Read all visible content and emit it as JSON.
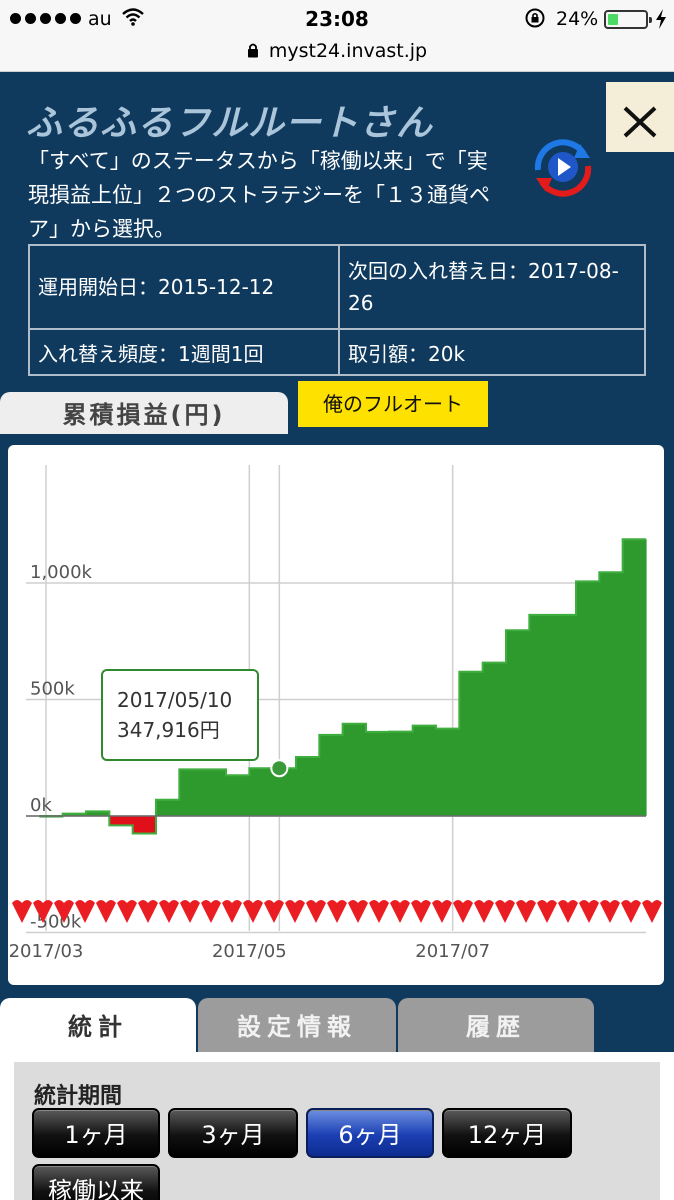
{
  "status_bar": {
    "carrier": "au",
    "time": "23:08",
    "battery_pct": "24%",
    "battery_level": 0.24
  },
  "url_bar": {
    "url": "myst24.invast.jp"
  },
  "header": {
    "title": "ふるふるフルルートさん",
    "description": "「すべて」のステータスから「稼働以来」で「実現損益上位」２つのストラテジーを「１３通貨ペア」から選択。"
  },
  "info": {
    "start_date": "運用開始日：2015-12-12",
    "next_swap_date": "次回の入れ替え日：2017-08-26",
    "swap_freq": "入れ替え頻度：1週間1回",
    "trade_amount": "取引額：20k"
  },
  "tabs_top": {
    "chart_tab": "累積損益(円)",
    "auto_tab": "俺のフルオート"
  },
  "chart_data": {
    "type": "area",
    "xlabel": "",
    "ylabel": "",
    "x_ticks": [
      "2017/03",
      "2017/05",
      "2017/07"
    ],
    "y_ticks": [
      "1,000k",
      "500k",
      "0k",
      "-500k"
    ],
    "ylim": [
      -500000,
      1300000
    ],
    "grid": true,
    "x": [
      "2017/02/27",
      "2017/03/06",
      "2017/03/13",
      "2017/03/20",
      "2017/03/27",
      "2017/04/03",
      "2017/04/10",
      "2017/04/17",
      "2017/04/24",
      "2017/05/01",
      "2017/05/08",
      "2017/05/15",
      "2017/05/22",
      "2017/05/29",
      "2017/06/05",
      "2017/06/12",
      "2017/06/19",
      "2017/06/26",
      "2017/07/03",
      "2017/07/10",
      "2017/07/17",
      "2017/07/24",
      "2017/07/31",
      "2017/08/07",
      "2017/08/14",
      "2017/08/21"
    ],
    "values": [
      0,
      10000,
      20000,
      -40000,
      -75000,
      70000,
      200000,
      200000,
      175000,
      205000,
      205000,
      253000,
      347916,
      396000,
      361000,
      362000,
      388000,
      375000,
      619000,
      658000,
      797000,
      863000,
      863000,
      1007000,
      1046000,
      1188000
    ],
    "positive_color": "#2e9a2e",
    "negative_color": "#e0101b",
    "tooltip": {
      "date": "2017/05/10",
      "value": "347,916円"
    }
  },
  "tabs_bottom": {
    "stats": "統計",
    "settings": "設定情報",
    "history": "履歴"
  },
  "stats": {
    "period_label": "統計期間",
    "periods": [
      "1ヶ月",
      "3ヶ月",
      "6ヶ月",
      "12ヶ月",
      "稼働以来"
    ],
    "selected_period": "6ヶ月"
  }
}
